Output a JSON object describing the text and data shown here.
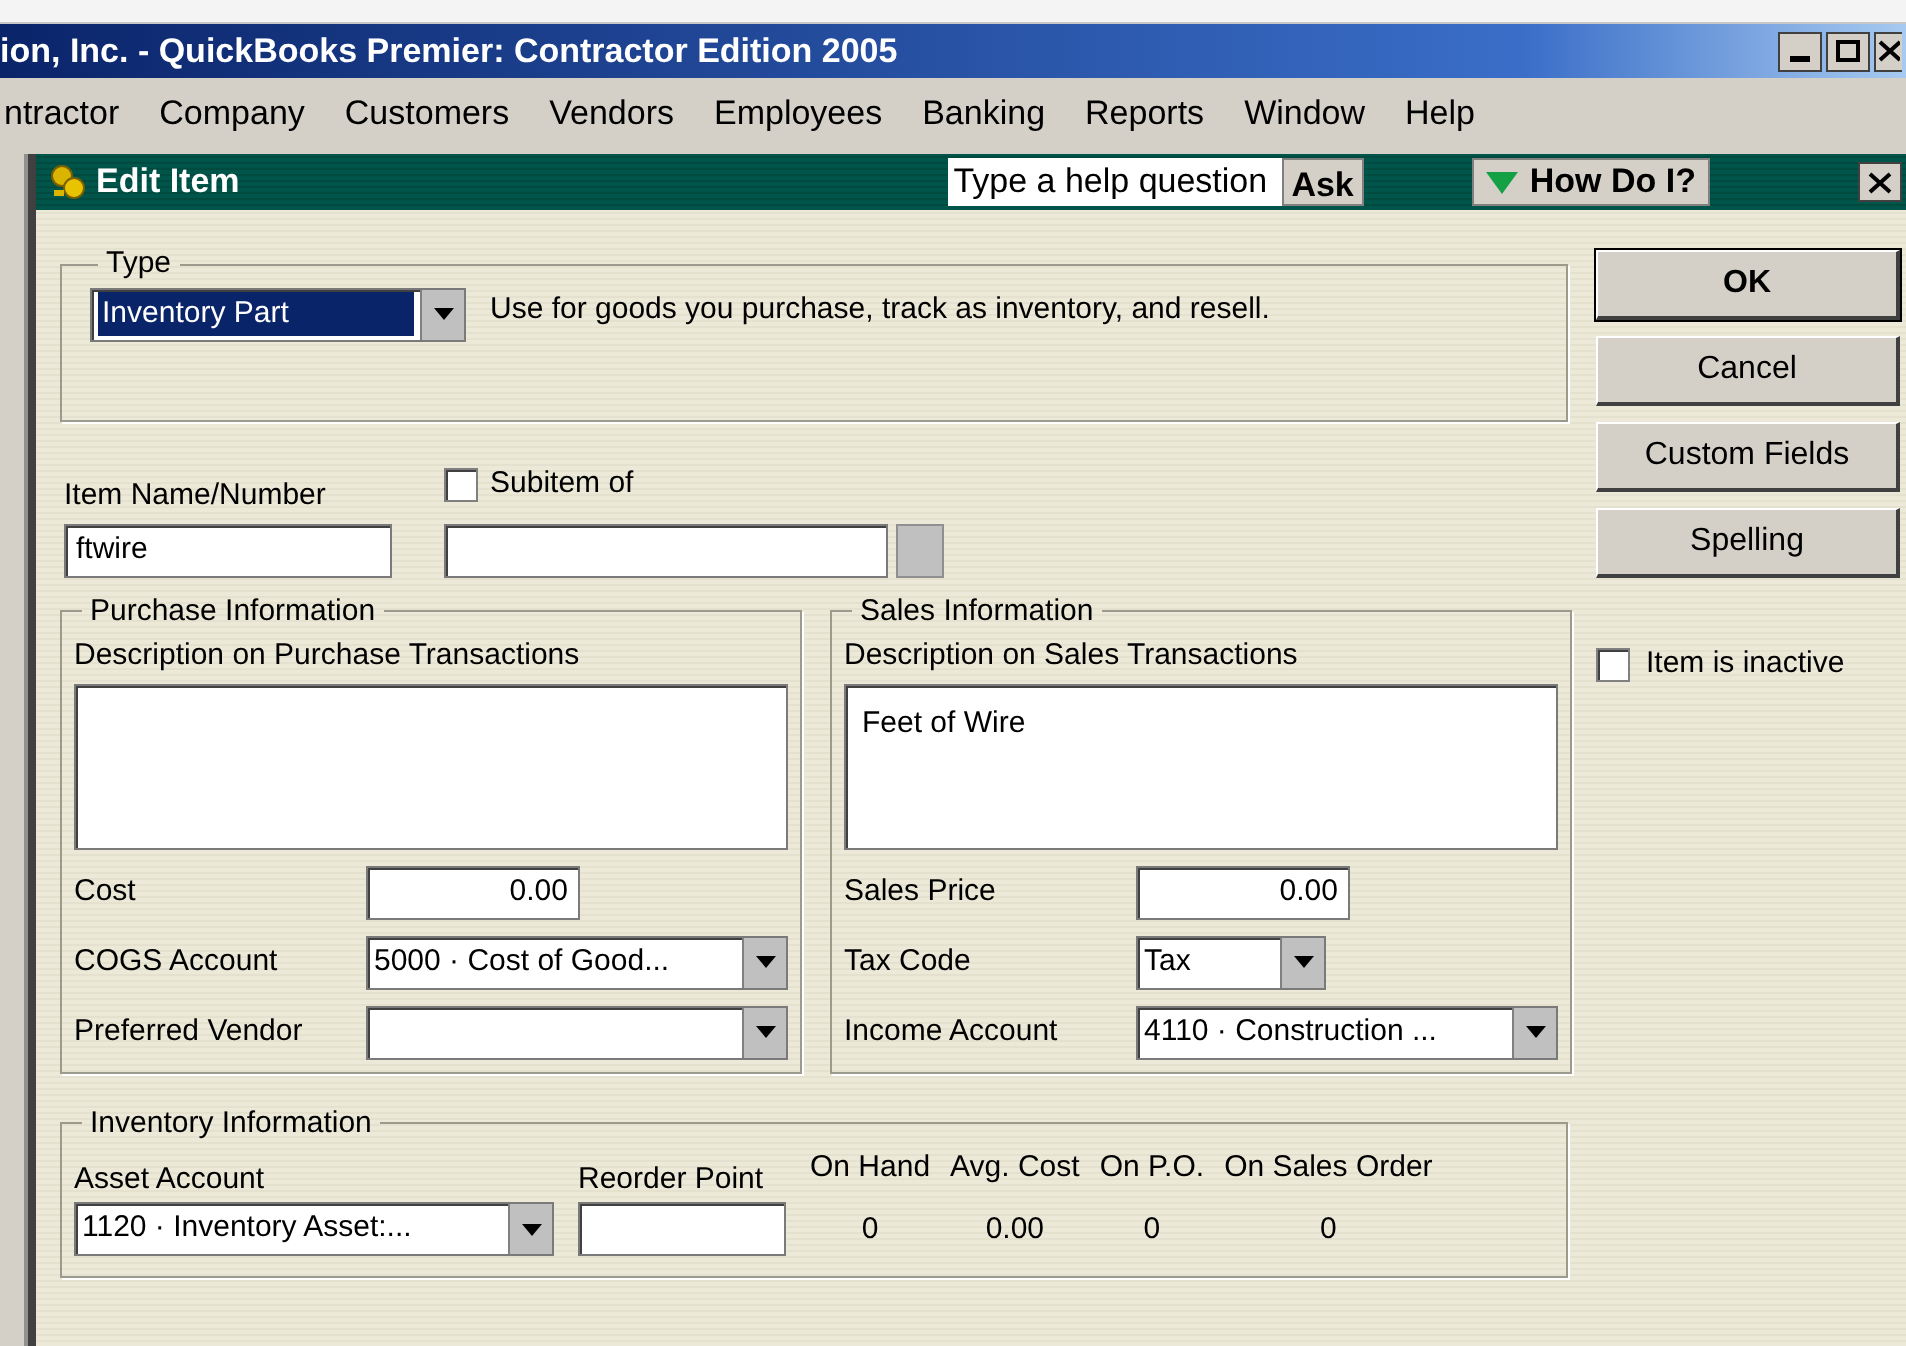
{
  "title_bar": {
    "title": "ion, Inc. - QuickBooks Premier: Contractor Edition 2005"
  },
  "menu_bar": [
    "ntractor",
    "Company",
    "Customers",
    "Vendors",
    "Employees",
    "Banking",
    "Reports",
    "Window",
    "Help"
  ],
  "dialog": {
    "title": "Edit Item",
    "help_field": {
      "placeholder": "Type a help question"
    },
    "ask_button": "Ask",
    "how_do_i_button": "How Do I?"
  },
  "type_group": {
    "label": "Type",
    "dropdown": {
      "value": "Inventory Part",
      "focused": true
    },
    "description": "Use for goods you purchase, track as inventory, and resell."
  },
  "item_name": {
    "label": "Item Name/Number",
    "value": "ftwire"
  },
  "subitem": {
    "label": "Subitem of",
    "checked": false
  },
  "purchase": {
    "title": "Purchase Information",
    "description_label": "Description on Purchase Transactions",
    "fields": [
      {
        "label": "Cost",
        "kind": "number",
        "value": "0.00"
      },
      {
        "label": "COGS Account",
        "kind": "dropdown",
        "value": "5000 · Cost of Good..."
      },
      {
        "label": "Preferred Vendor",
        "kind": "dropdown"
      }
    ]
  },
  "sales": {
    "title": "Sales Information",
    "description_label": "Description on Sales Transactions",
    "description": "Feet of Wire",
    "fields": [
      {
        "label": "Sales Price",
        "kind": "number",
        "value": "0.00"
      },
      {
        "label": "Tax Code",
        "kind": "small_dropdown",
        "value": "Tax"
      },
      {
        "label": "Income Account",
        "kind": "dropdown",
        "value": "4110 · Construction ..."
      }
    ]
  },
  "inventory": {
    "title": "Inventory Information",
    "asset_account": {
      "label": "Asset Account",
      "value": "1120 · Inventory Asset:..."
    },
    "reorder_point": {
      "label": "Reorder Point"
    },
    "stats": [
      {
        "label": "On Hand",
        "value": "0"
      },
      {
        "label": "Avg. Cost",
        "value": "0.00"
      },
      {
        "label": "On P.O.",
        "value": "0"
      },
      {
        "label": "On Sales Order",
        "value": "0"
      }
    ]
  },
  "buttons": [
    {
      "label": "OK",
      "default": true
    },
    {
      "label": "Cancel",
      "default": false
    },
    {
      "label": "Custom Fields",
      "default": false
    },
    {
      "label": "Spelling",
      "default": false
    }
  ],
  "inactive": {
    "label": "Item is inactive",
    "checked": false
  }
}
